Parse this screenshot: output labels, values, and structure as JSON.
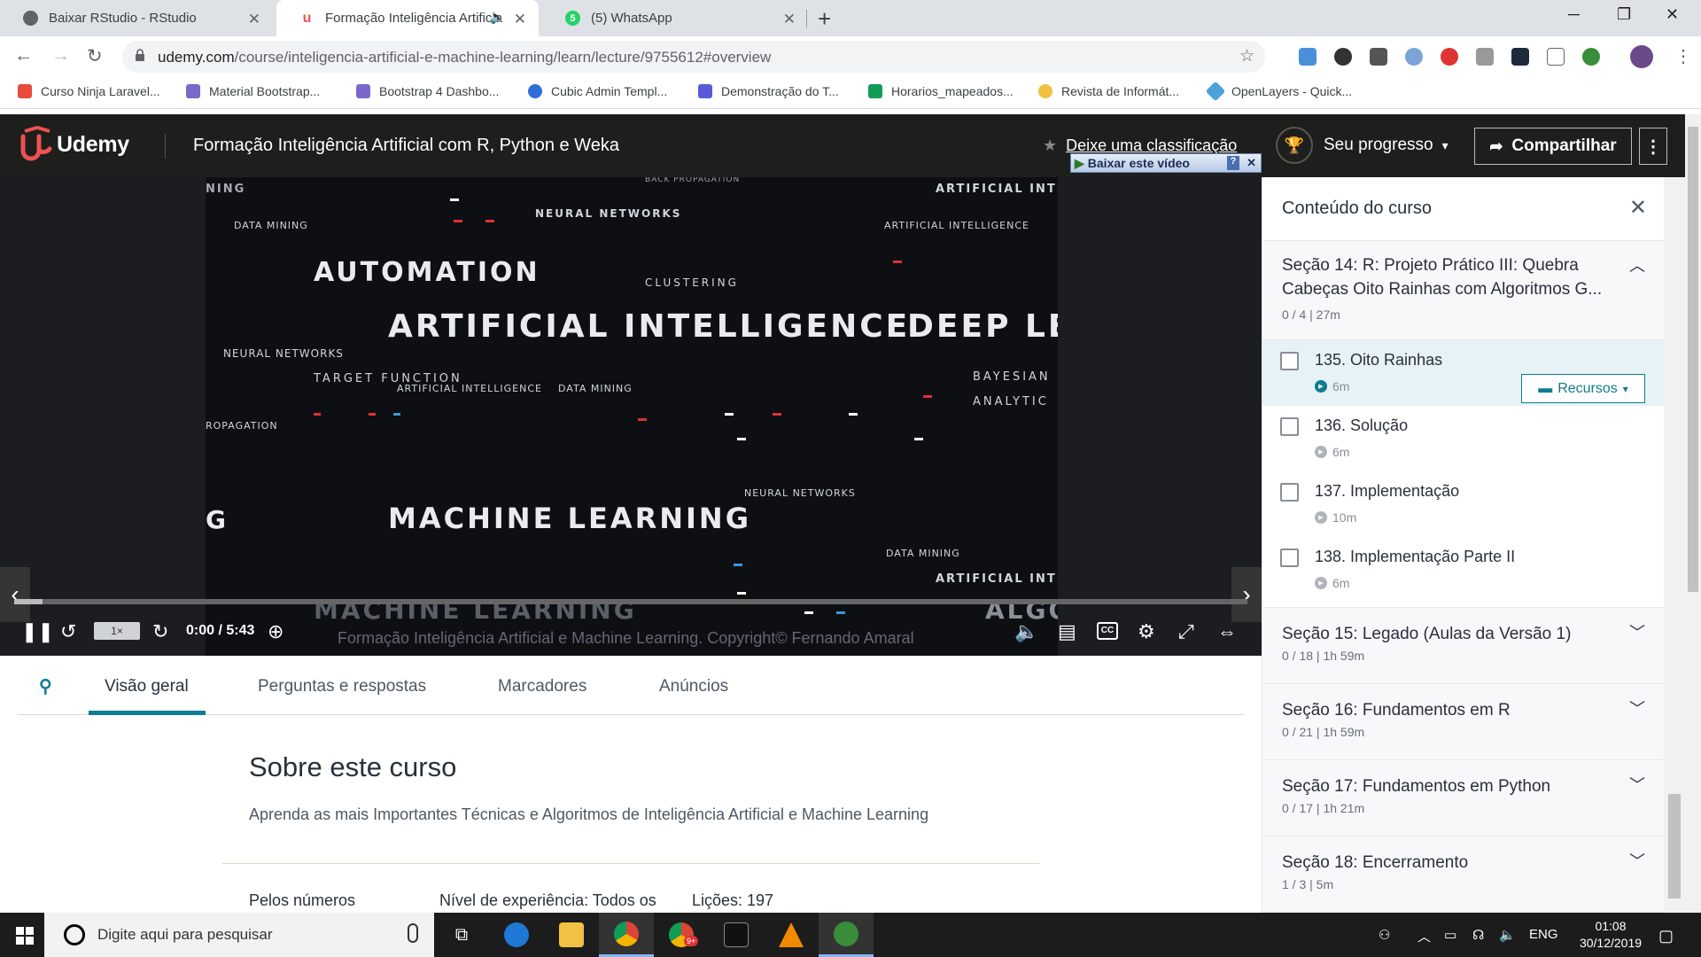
{
  "browser": {
    "tabs": [
      {
        "title": "Baixar RStudio - RStudio",
        "active": false
      },
      {
        "title": "Formação Inteligência Artificial",
        "active": true
      },
      {
        "title": "(5) WhatsApp",
        "active": false
      }
    ],
    "url_host": "udemy.com",
    "url_path": "/course/inteligencia-artificial-e-machine-learning/learn/lecture/9755612#overview",
    "bookmarks": [
      "Curso Ninja Laravel...",
      "Material Bootstrap...",
      "Bootstrap 4 Dashbo...",
      "Cubic Admin Templ...",
      "Demonstração do T...",
      "Horarios_mapeados...",
      "Revista de Informát...",
      "OpenLayers - Quick..."
    ]
  },
  "header": {
    "brand": "Udemy",
    "course_title": "Formação Inteligência Artificial com R, Python e Weka",
    "rate_label": "Deixe uma classificação",
    "progress_label": "Seu progresso",
    "share_label": "Compartilhar",
    "download_bar": "Baixar este vídeo"
  },
  "video": {
    "frame_words": {
      "automation": "AUTOMATION",
      "ai": "ARTIFICIAL INTELLIGENCE",
      "deep": "DEEP LEA",
      "ml": "MACHINE LEARNING",
      "ml_ghost": "MACHINE LEARNING",
      "neural": "NEURAL NETWORKS",
      "neural2": "NEURAL NETWORKS",
      "neural3": "NEURAL NETWORKS",
      "data_mining": "DATA MINING",
      "data_mining2": "DATA MINING",
      "data_mining3": "DATA MINING",
      "target": "TARGET FUNCTION",
      "clustering": "CLUSTERING",
      "bayesian": "BAYESIAN",
      "analytic": "ANALYTIC",
      "ai_small": "ARTIFICIAL INTELLIGENCE",
      "ai_small2": "ARTIFICIAL INTELLIGENCE",
      "ai_small3": "ARTIFICIAL INTELLIG",
      "ai_small4": "ARTIFICIAL INTELLIG",
      "backprop": "BACK PROPAGATION",
      "ropagation": "ROPAGATION",
      "ning": "NING",
      "algo": "ALGO",
      "g": "G"
    },
    "speed": "1×",
    "time": "0:00 / 5:43",
    "watermark": "Formação Inteligência Artificial e Machine Learning. Copyright© Fernando Amaral",
    "progress_fraction": 0.023
  },
  "subnav": {
    "tabs": [
      "Visão geral",
      "Perguntas e respostas",
      "Marcadores",
      "Anúncios"
    ]
  },
  "overview": {
    "heading": "Sobre este curso",
    "description": "Aprenda as mais Importantes Técnicas e Algoritmos de Inteligência Artificial e Machine Learning",
    "numbers_label": "Pelos números",
    "level": "Nível de experiência: Todos os",
    "lessons": "Lições: 197"
  },
  "sidebar": {
    "title": "Conteúdo do curso",
    "current_section": {
      "title_line1": "Seção 14: R: Projeto Prático III: Quebra",
      "title_line2": "Cabeças Oito Rainhas com Algoritmos G...",
      "meta": "0 / 4  |  27m"
    },
    "lessons": [
      {
        "title": "135. Oito Rainhas",
        "duration": "6m",
        "current": true
      },
      {
        "title": "136. Solução",
        "duration": "6m",
        "current": false
      },
      {
        "title": "137. Implementação",
        "duration": "10m",
        "current": false
      },
      {
        "title": "138. Implementação Parte II",
        "duration": "6m",
        "current": false
      }
    ],
    "resources_label": "Recursos",
    "sections": [
      {
        "title": "Seção 15: Legado (Aulas da Versão 1)",
        "meta": "0 / 18  |  1h 59m"
      },
      {
        "title": "Seção 16: Fundamentos em R",
        "meta": "0 / 21  |  1h 59m"
      },
      {
        "title": "Seção 17: Fundamentos em Python",
        "meta": "0 / 17  |  1h 21m"
      },
      {
        "title": "Seção 18: Encerramento",
        "meta": "1 / 3  |  5m"
      }
    ]
  },
  "taskbar": {
    "search_placeholder": "Digite aqui para pesquisar",
    "lang": "ENG",
    "time": "01:08",
    "date": "30/12/2019",
    "badge": "9+"
  },
  "colors": {
    "udemy_red": "#ec5252",
    "teal": "#0f7c90",
    "header_bg": "#1e1e1c"
  }
}
